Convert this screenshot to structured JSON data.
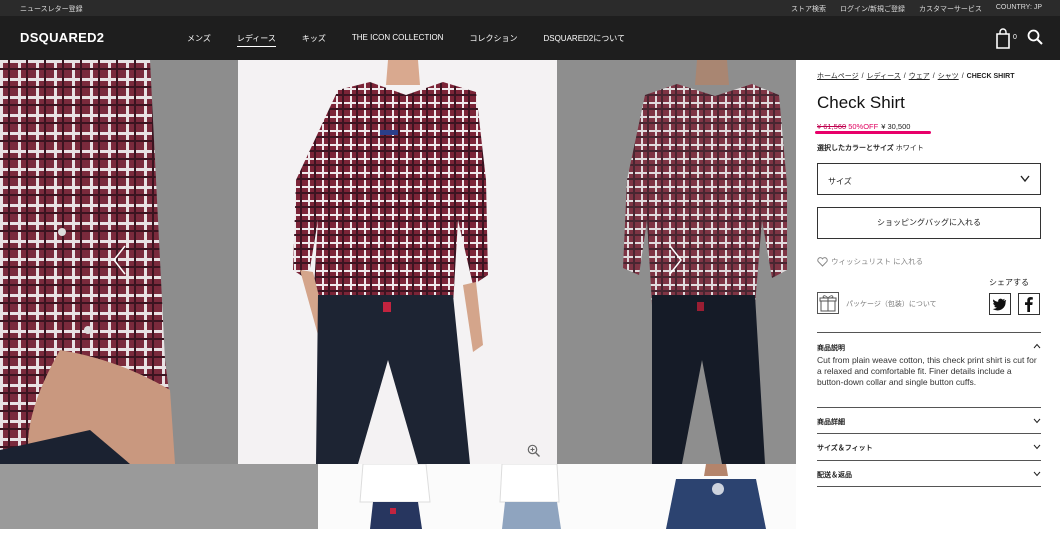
{
  "utilbar": {
    "newsletter": "ニュースレター登録",
    "links": [
      "ストア検索",
      "ログイン/新規ご登録",
      "カスタマーサービス",
      "COUNTRY: JP"
    ]
  },
  "nav": {
    "logo": "DSQUARED2",
    "items": [
      "メンズ",
      "レディース",
      "キッズ",
      "THE ICON COLLECTION",
      "コレクション",
      "DSQUARED2について"
    ],
    "active_index": 1,
    "cart_count": "0"
  },
  "product": {
    "breadcrumb": [
      "ホームページ",
      "レディース",
      "ウェア",
      "シャツ",
      "CHECK SHIRT"
    ],
    "title": "Check Shirt",
    "price_old": "¥ 61,560",
    "discount": "50%OFF",
    "price_new": "¥ 30,500",
    "color_label": "選択したカラーとサイズ",
    "color_value": "ホワイト",
    "size_label": "サイズ",
    "add_to_bag": "ショッピングバッグに入れる",
    "wishlist": "ウィッシュリスト に入れる",
    "share": "シェアする",
    "package": "パッケージ（包装）について",
    "sections": [
      {
        "title": "商品説明",
        "open": true
      },
      {
        "title": "商品詳細",
        "open": false
      },
      {
        "title": "サイズ＆フィット",
        "open": false
      },
      {
        "title": "配送＆返品",
        "open": false
      }
    ],
    "description": "Cut from plain weave cotton, this check print shirt is cut for a relaxed and comfortable fit. Finer details include a button-down collar and single button cuffs."
  },
  "colors": {
    "accent": "#e8006a",
    "shirt": "#6e1f35",
    "denim": "#1d2433"
  }
}
